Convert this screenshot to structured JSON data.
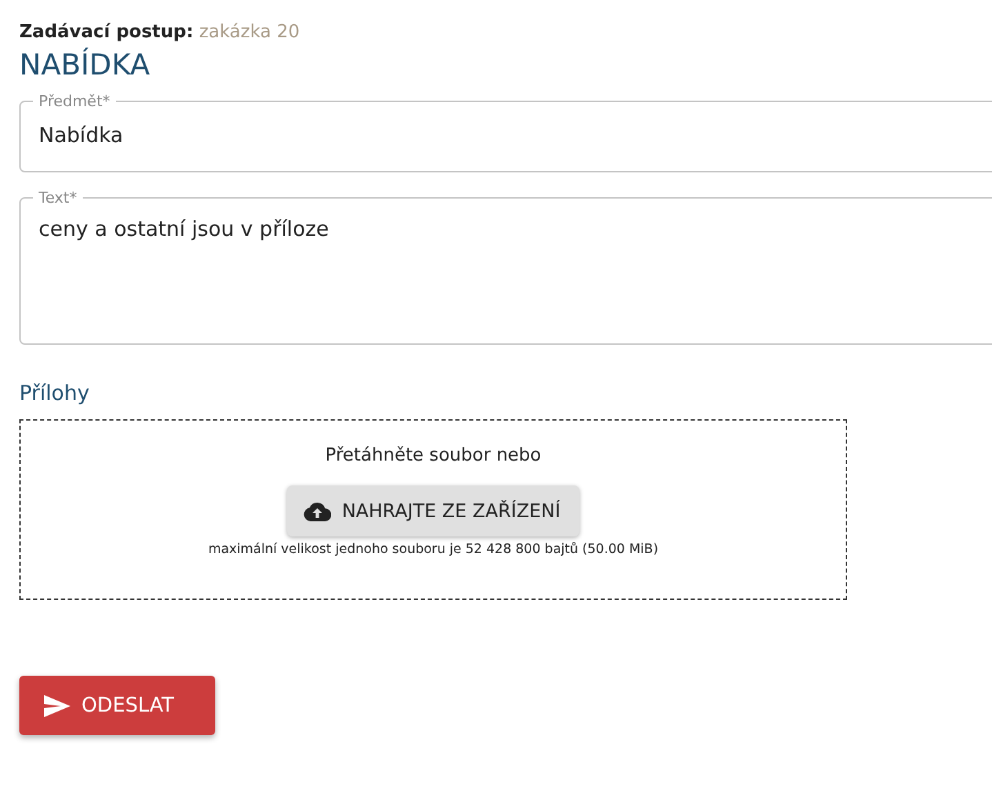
{
  "header": {
    "label": "Zadávací postup:",
    "value": "zakázka 20"
  },
  "title": "NABÍDKA",
  "fields": [
    {
      "kind": "input",
      "label": "Předmět*",
      "value": "Nabídka"
    },
    {
      "kind": "textarea",
      "label": "Text*",
      "value": "ceny a ostatní jsou v příloze"
    }
  ],
  "attachments": {
    "title": "Přílohy",
    "hint": "Přetáhněte soubor nebo",
    "button": "NAHRAJTE ZE ZAŘÍZENÍ",
    "note": "maximální velikost jednoho souboru je 52 428 800 bajtů (50.00 MiB)"
  },
  "submit": "ODESLAT"
}
